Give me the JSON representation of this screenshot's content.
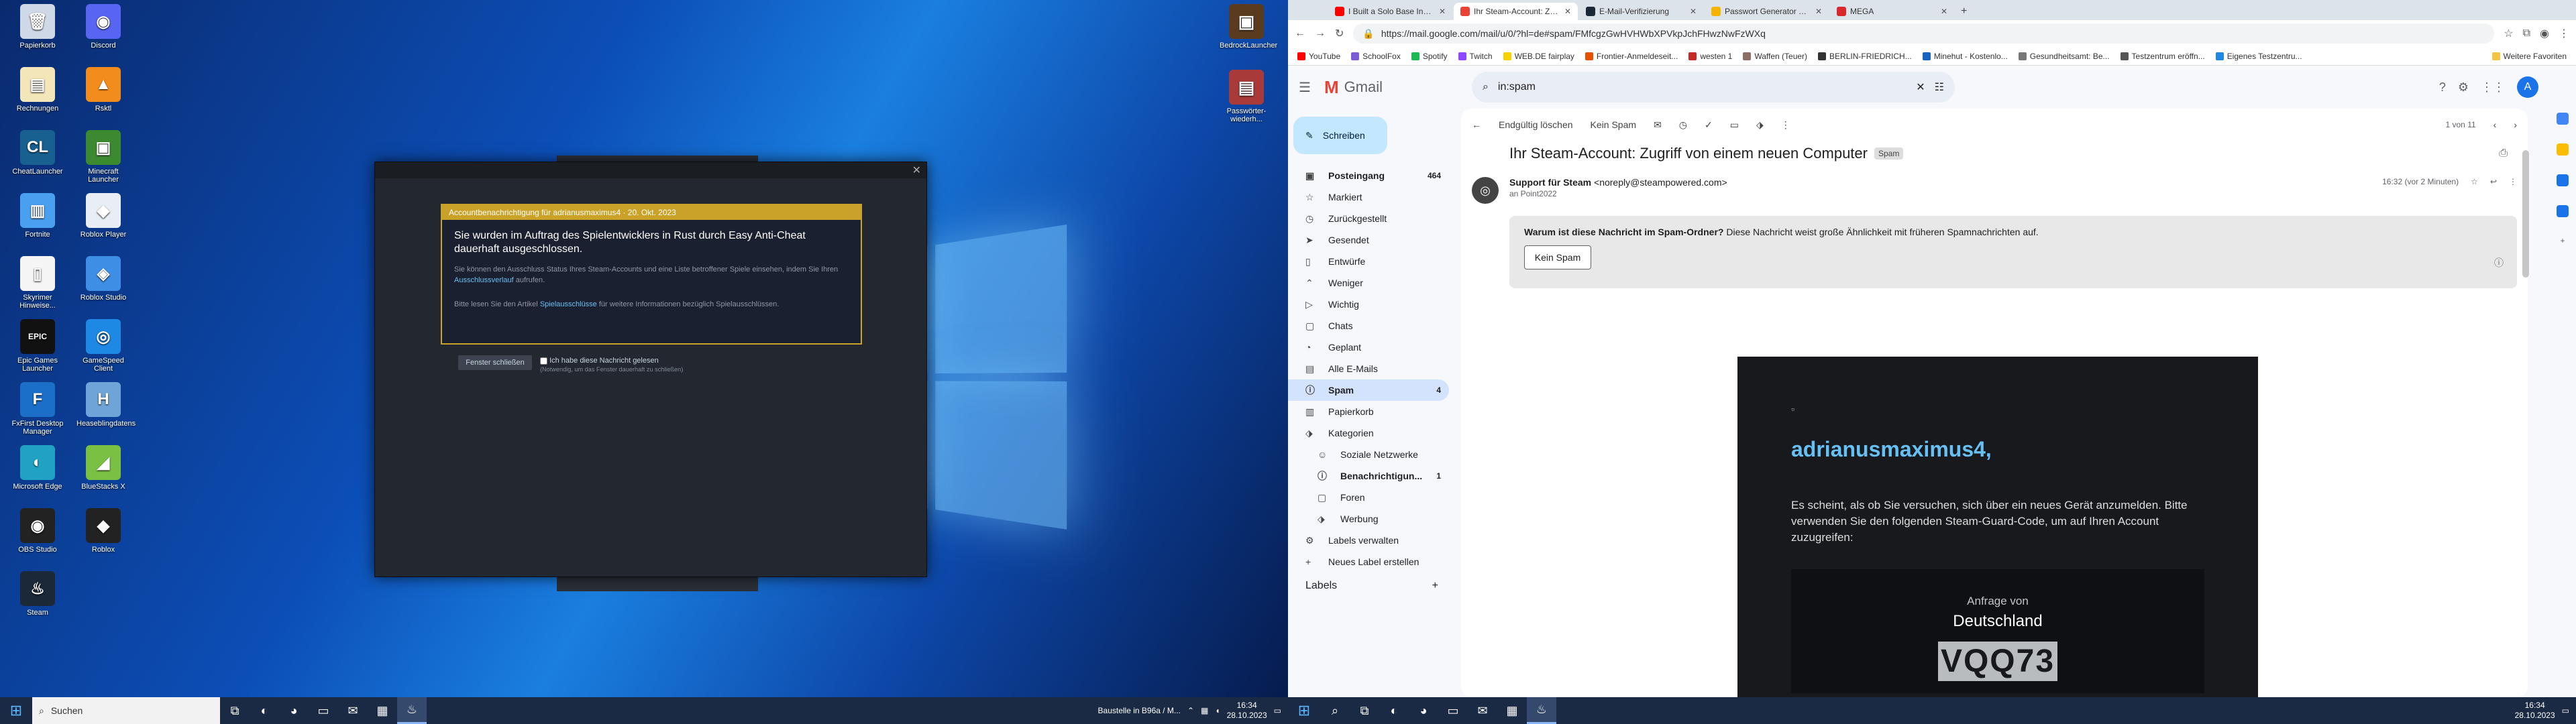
{
  "desktop": {
    "left_icons": [
      {
        "label": "Papierkorb",
        "icon": "recycle-bin-icon",
        "color": "#cfd8e6",
        "glyph": "🗑"
      },
      {
        "label": "Discord",
        "icon": "discord-icon",
        "color": "#5865f2",
        "glyph": "◉"
      },
      {
        "label": "Rechnungen",
        "icon": "document-icon",
        "color": "#f3e6b8",
        "glyph": "▤"
      },
      {
        "label": "Rsktl",
        "icon": "vlc-icon",
        "color": "#f28c1c",
        "glyph": "▲"
      },
      {
        "label": "CheatLauncher",
        "icon": "cl-icon",
        "color": "#18608f",
        "glyph": "CL"
      },
      {
        "label": "Minecraft Launcher",
        "icon": "minecraft-icon",
        "color": "#3c8a2f",
        "glyph": "▣"
      },
      {
        "label": "Fortnite",
        "icon": "fortnite-icon",
        "color": "#4aa0f0",
        "glyph": "▥"
      },
      {
        "label": "Roblox Player",
        "icon": "roblox-icon",
        "color": "#e9eef5",
        "glyph": "◆"
      },
      {
        "label": "Skyrimer Hinweise...",
        "icon": "file-icon",
        "color": "#f5f5f5",
        "glyph": "▯"
      },
      {
        "label": "Roblox Studio",
        "icon": "roblox-studio-icon",
        "color": "#3f8ee5",
        "glyph": "◈"
      },
      {
        "label": "Epic Games Launcher",
        "icon": "epic-icon",
        "color": "#111111",
        "glyph": "EPIC"
      },
      {
        "label": "GameSpeed Client",
        "icon": "gamespeed-icon",
        "color": "#1e88e5",
        "glyph": "◎"
      },
      {
        "label": "FxFirst Desktop Manager",
        "icon": "fx-icon",
        "color": "#1b6fc7",
        "glyph": "F"
      },
      {
        "label": "Heaseblingdatens",
        "icon": "heaseb-icon",
        "color": "#6fa4d8",
        "glyph": "H"
      },
      {
        "label": "Microsoft Edge",
        "icon": "edge-icon",
        "color": "#1fa2c4",
        "glyph": "◐"
      },
      {
        "label": "BlueStacks X",
        "icon": "bluestacks-icon",
        "color": "#7ac043",
        "glyph": "◢"
      },
      {
        "label": "OBS Studio",
        "icon": "obs-icon",
        "color": "#222222",
        "glyph": "◉"
      },
      {
        "label": "Roblox",
        "icon": "roblox-app-icon",
        "color": "#222222",
        "glyph": "◆"
      },
      {
        "label": "Steam",
        "icon": "steam-icon",
        "color": "#1b2838",
        "glyph": "♨"
      }
    ],
    "right_icons": [
      {
        "label": "BedrockLauncher",
        "icon": "bedrock-icon",
        "color": "#5a3b1f",
        "glyph": "▣"
      },
      {
        "label": "Passwörter-wiederh...",
        "icon": "archive-icon",
        "color": "#a83a3a",
        "glyph": "▤"
      }
    ]
  },
  "steam_dialog": {
    "close_glyph": "✕",
    "header": "Accountbenachrichtigung für adrianusmaximus4 · 20. Okt. 2023",
    "title": "Sie wurden im Auftrag des Spielentwicklers in Rust durch Easy Anti-Cheat dauerhaft ausgeschlossen.",
    "body1": "Sie können den Ausschluss Status Ihres Steam-Accounts und eine Liste betroffener Spiele einsehen, indem Sie Ihren",
    "body1_link": "Ausschlussverlauf",
    "body1_end": "aufrufen.",
    "body2": "Bitte lesen Sie den Artikel",
    "body2_link": "Spielausschlüsse",
    "body2_end": "für weitere Informationen bezüglich Spielausschlüssen.",
    "close_button": "Fenster schließen",
    "checkbox_label": "Ich habe diese Nachricht gelesen",
    "checkbox_hint": "(Notwendig, um das Fenster dauerhaft zu schließen)"
  },
  "taskbar_left": {
    "search_placeholder": "Suchen",
    "apps": [
      {
        "icon": "task-view-icon",
        "glyph": "⧉",
        "active": false
      },
      {
        "icon": "edge-icon",
        "glyph": "◐",
        "active": false
      },
      {
        "icon": "chrome-icon",
        "glyph": "◕",
        "active": false
      },
      {
        "icon": "explorer-icon",
        "glyph": "▭",
        "active": false
      },
      {
        "icon": "mail-icon",
        "glyph": "✉",
        "active": false
      },
      {
        "icon": "calc-icon",
        "glyph": "▦",
        "active": false
      },
      {
        "icon": "steam-icon",
        "glyph": "♨",
        "active": true
      }
    ],
    "notification": "Baustelle in B96a / M...",
    "time": "16:34",
    "date": "28.10.2023"
  },
  "browser": {
    "tabs": [
      {
        "title": "I Built a Solo Base Inside my Fri...",
        "color": "#ff0000",
        "active": false
      },
      {
        "title": "Ihr Steam-Account: Zugriff von e...",
        "color": "#ea4335",
        "active": true
      },
      {
        "title": "E-Mail-Verifizierung",
        "color": "#1b2838",
        "active": false
      },
      {
        "title": "Passwort Generator ⚿ – Sichere...",
        "color": "#f4b400",
        "active": false
      },
      {
        "title": "MEGA",
        "color": "#d9272e",
        "active": false
      }
    ],
    "url": "https://mail.google.com/mail/u/0/?hl=de#spam/FMfcgzGwHVHWbXPVkpJchFHwzNwFzWXq",
    "bookmarks": [
      {
        "label": "YouTube",
        "color": "#ff0000"
      },
      {
        "label": "SchoolFox",
        "color": "#7b5cd6"
      },
      {
        "label": "Spotify",
        "color": "#1db954"
      },
      {
        "label": "Twitch",
        "color": "#9146ff"
      },
      {
        "label": "WEB.DE fairplay",
        "color": "#f8d100"
      },
      {
        "label": "Frontier-Anmeldeseit...",
        "color": "#e65100"
      },
      {
        "label": "westen 1",
        "color": "#c62828"
      },
      {
        "label": "Waffen (Teuer)",
        "color": "#8d6e63"
      },
      {
        "label": "BERLIN-FRIEDRICH...",
        "color": "#333333"
      },
      {
        "label": "Minehut - Kostenlo...",
        "color": "#1565c0"
      },
      {
        "label": "Gesundheitsamt: Be...",
        "color": "#777777"
      },
      {
        "label": "Testzentrum eröffn...",
        "color": "#555555"
      },
      {
        "label": "Eigenes Testzentru...",
        "color": "#1e88e5"
      }
    ],
    "bookmarks_more": "Weitere Favoriten"
  },
  "gmail": {
    "logo": "Gmail",
    "search_value": "in:spam",
    "compose": "Schreiben",
    "nav": [
      {
        "label": "Posteingang",
        "count": "464",
        "icon": "inbox-icon",
        "bold": true,
        "sel": false,
        "sub": false
      },
      {
        "label": "Markiert",
        "count": "",
        "icon": "star-icon",
        "bold": false,
        "sel": false,
        "sub": false
      },
      {
        "label": "Zurückgestellt",
        "count": "",
        "icon": "clock-icon",
        "bold": false,
        "sel": false,
        "sub": false
      },
      {
        "label": "Gesendet",
        "count": "",
        "icon": "send-icon",
        "bold": false,
        "sel": false,
        "sub": false
      },
      {
        "label": "Entwürfe",
        "count": "",
        "icon": "draft-icon",
        "bold": false,
        "sel": false,
        "sub": false
      },
      {
        "label": "Weniger",
        "count": "",
        "icon": "chevron-up-icon",
        "bold": false,
        "sel": false,
        "sub": false
      },
      {
        "label": "Wichtig",
        "count": "",
        "icon": "important-icon",
        "bold": false,
        "sel": false,
        "sub": false
      },
      {
        "label": "Chats",
        "count": "",
        "icon": "chat-icon",
        "bold": false,
        "sel": false,
        "sub": false
      },
      {
        "label": "Geplant",
        "count": "",
        "icon": "schedule-icon",
        "bold": false,
        "sel": false,
        "sub": false
      },
      {
        "label": "Alle E-Mails",
        "count": "",
        "icon": "allmail-icon",
        "bold": false,
        "sel": false,
        "sub": false
      },
      {
        "label": "Spam",
        "count": "4",
        "icon": "spam-icon",
        "bold": true,
        "sel": true,
        "sub": false
      },
      {
        "label": "Papierkorb",
        "count": "",
        "icon": "trash-icon",
        "bold": false,
        "sel": false,
        "sub": false
      },
      {
        "label": "Kategorien",
        "count": "",
        "icon": "label-icon",
        "bold": false,
        "sel": false,
        "sub": false
      },
      {
        "label": "Soziale Netzwerke",
        "count": "",
        "icon": "people-icon",
        "bold": false,
        "sel": false,
        "sub": true
      },
      {
        "label": "Benachrichtigun...",
        "count": "1",
        "icon": "info-icon",
        "bold": true,
        "sel": false,
        "sub": true
      },
      {
        "label": "Foren",
        "count": "",
        "icon": "forum-icon",
        "bold": false,
        "sel": false,
        "sub": true
      },
      {
        "label": "Werbung",
        "count": "",
        "icon": "tag-icon",
        "bold": false,
        "sel": false,
        "sub": true
      },
      {
        "label": "Labels verwalten",
        "count": "",
        "icon": "gear-icon",
        "bold": false,
        "sel": false,
        "sub": false
      },
      {
        "label": "Neues Label erstellen",
        "count": "",
        "icon": "plus-icon",
        "bold": false,
        "sel": false,
        "sub": false
      }
    ],
    "labels_heading": "Labels",
    "actions": {
      "delete": "Endgültig löschen",
      "not_spam": "Kein Spam",
      "pagination": "1 von 11"
    },
    "email": {
      "subject": "Ihr Steam-Account: Zugriff von einem neuen Computer",
      "chip": "Spam",
      "sender_name": "Support für Steam",
      "sender_email": "<noreply@steampowered.com>",
      "to": "an Point2022",
      "time": "16:32 (vor 2 Minuten)",
      "spam_question": "Warum ist diese Nachricht im Spam-Ordner?",
      "spam_reason": "Diese Nachricht weist große Ähnlichkeit mit früheren Spamnachrichten auf.",
      "spam_button": "Kein Spam",
      "greeting": "adrianusmaximus4,",
      "text": "Es scheint, als ob Sie versuchen, sich über ein neues Gerät anzumelden. Bitte verwenden Sie den folgenden Steam-Guard-Code, um auf Ihren Account zuzugreifen:",
      "request_from": "Anfrage von",
      "country": "Deutschland",
      "code": "VQQ73"
    }
  },
  "taskbar_right": {
    "time": "16:34",
    "date": "28.10.2023"
  }
}
